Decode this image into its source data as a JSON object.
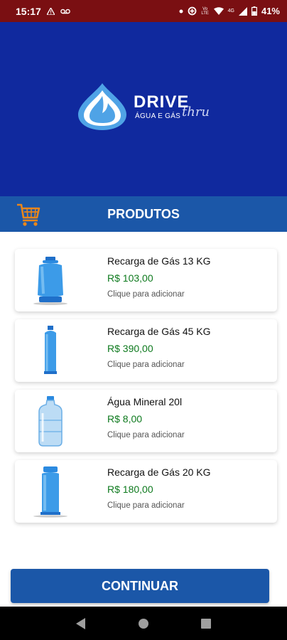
{
  "status_bar": {
    "time": "15:17",
    "battery": "41%",
    "network": "4G",
    "volte": "Vo LTE",
    "icons": [
      "alert-icon",
      "voicemail-icon",
      "dot-icon",
      "data-saver-icon",
      "wifi-icon",
      "signal-icon",
      "battery-icon"
    ]
  },
  "brand": {
    "name": "DRIVE",
    "tagline": "ÁGUA E GÁS",
    "script": "thru",
    "color": "#10299e"
  },
  "header": {
    "title": "PRODUTOS",
    "accent": "#1b57a8"
  },
  "products": [
    {
      "name": "Recarga de Gás 13 KG",
      "price": "R$ 103,00",
      "hint": "Clique para adicionar",
      "icon": "gas-cylinder-13kg-icon"
    },
    {
      "name": "Recarga de Gás 45 KG",
      "price": "R$ 390,00",
      "hint": "Clique para adicionar",
      "icon": "gas-cylinder-45kg-icon"
    },
    {
      "name": "Água Mineral 20l",
      "price": "R$ 8,00",
      "hint": "Clique para adicionar",
      "icon": "water-jug-icon"
    },
    {
      "name": "Recarga de Gás 20 KG",
      "price": "R$ 180,00",
      "hint": "Clique para adicionar",
      "icon": "gas-cylinder-20kg-icon"
    }
  ],
  "continue_label": "CONTINUAR",
  "colors": {
    "status_bar": "#7a0f12",
    "price": "#0e7a1e",
    "cart": "#e8861c"
  }
}
